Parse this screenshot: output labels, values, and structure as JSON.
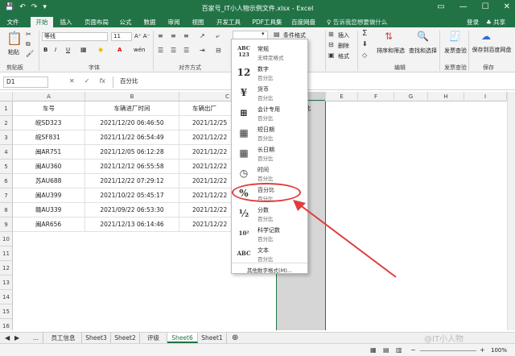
{
  "window": {
    "title": "百家号_IT小人物示例文件.xlsx - Excel",
    "controls": [
      "▭",
      "—",
      "☐",
      "✕"
    ]
  },
  "tabs": [
    "文件",
    "开始",
    "插入",
    "页面布局",
    "公式",
    "数据",
    "审阅",
    "视图",
    "开发工具",
    "PDF工具集",
    "百度网盘"
  ],
  "active_tab": "开始",
  "tell_me": "♀ 告诉我您想要做什么",
  "login": "登录",
  "share": "♣ 共享",
  "ribbon": {
    "paste": "粘贴",
    "font_name": "等线",
    "font_size": "11",
    "font_grow": "A⁺ A⁻",
    "bold": "B",
    "italic": "I",
    "underline": "U",
    "font_color": "A",
    "wen": "wén",
    "cond_format": "条件格式",
    "insert": "插入",
    "delete": "删除",
    "format": "格式",
    "sort_filter": "排序和筛选",
    "find_select": "查找和选择",
    "invoice_check": "发票查验",
    "save_baidu": "保存到百度网盘",
    "groups": [
      "剪贴板",
      "字体",
      "对齐方式",
      "编辑",
      "发票查验",
      "保存"
    ]
  },
  "formula_bar": {
    "name_box": "D1",
    "cancel": "✕",
    "confirm": "✓",
    "fx": "fx",
    "content": "百分比"
  },
  "columns": [
    "A",
    "B",
    "C",
    "D",
    "E",
    "F",
    "G",
    "H",
    "I"
  ],
  "rows": [
    "1",
    "2",
    "3",
    "4",
    "5",
    "6",
    "7",
    "8",
    "9",
    "10",
    "11",
    "12",
    "13",
    "14",
    "15",
    "16"
  ],
  "table": {
    "headers": [
      "车号",
      "车辆进厂时间",
      "车辆出厂",
      "比"
    ],
    "data": [
      [
        "皖SD323",
        "2021/12/20 06:46:50",
        "2021/12/25"
      ],
      [
        "皖SF831",
        "2021/11/22 06:54:49",
        "2021/12/22"
      ],
      [
        "闽AR751",
        "2021/12/05 06:12:28",
        "2021/12/22"
      ],
      [
        "闽AU360",
        "2021/12/12 06:55:58",
        "2021/12/22"
      ],
      [
        "苏AU688",
        "2021/12/22 07:29:12",
        "2021/12/22"
      ],
      [
        "闽AU399",
        "2021/10/22 05:45:17",
        "2021/12/22"
      ],
      [
        "赣AU339",
        "2021/09/22 06:53:30",
        "2021/12/22"
      ],
      [
        "闽AR656",
        "2021/12/13 06:14:46",
        "2021/12/22"
      ]
    ]
  },
  "number_format_box": "",
  "dropdown": {
    "items": [
      {
        "icon": "ABC\n123",
        "name": "常规",
        "sample": "无特定格式"
      },
      {
        "icon": "12",
        "name": "数字",
        "sample": "百分比"
      },
      {
        "icon": "¥",
        "name": "货币",
        "sample": "百分比"
      },
      {
        "icon": "⊞",
        "name": "会计专用",
        "sample": "百分比"
      },
      {
        "icon": "▦",
        "name": "短日期",
        "sample": "百分比"
      },
      {
        "icon": "▦",
        "name": "长日期",
        "sample": "百分比"
      },
      {
        "icon": "◷",
        "name": "时间",
        "sample": "百分比"
      },
      {
        "icon": "%",
        "name": "百分比",
        "sample": "百分比"
      },
      {
        "icon": "½",
        "name": "分数",
        "sample": "百分比"
      },
      {
        "icon": "10²",
        "name": "科学记数",
        "sample": "百分比"
      },
      {
        "icon": "ABC",
        "name": "文本",
        "sample": "百分比"
      }
    ],
    "more": "其他数字格式(M)..."
  },
  "sheets": [
    "...",
    "员工信息",
    "Sheet3",
    "Sheet2",
    "评级",
    "Sheet6",
    "Sheet1"
  ],
  "active_sheet": "Sheet6",
  "zoom": "100%",
  "watermark": "@IT小人物",
  "accent_color": "#217346"
}
